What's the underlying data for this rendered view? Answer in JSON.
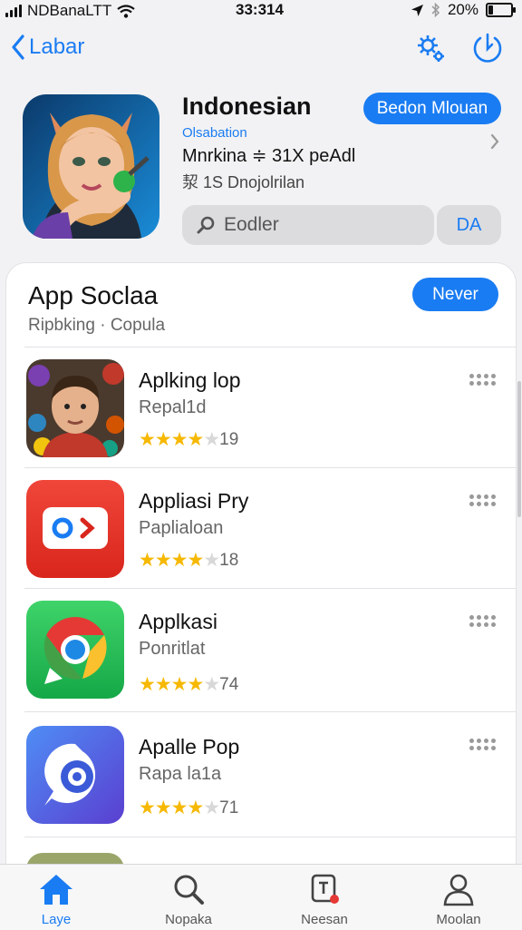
{
  "status": {
    "carrier": "NDBanaLTT",
    "time": "33:314",
    "battery": "20%"
  },
  "nav": {
    "back_label": "Labar",
    "icons": [
      "settings-gear-icon",
      "update-clock-icon"
    ]
  },
  "app": {
    "title": "Indonesian",
    "subtitle": "Olsabation",
    "line1": "Mnrkina ≑ 31X peAdl",
    "line2": "洯 1S Dnojolrilan",
    "get_label": "Bedon Mlouan",
    "search_placeholder": "Eodler",
    "search_button": "DA"
  },
  "section": {
    "title": "App Soclaa",
    "subtitle": "Ripbking · Copula",
    "button_label": "Never"
  },
  "apps": [
    {
      "name": "Aplking lop",
      "developer": "Repal1d",
      "stars": 4,
      "rating_count": "19"
    },
    {
      "name": "Appliasi Pry",
      "developer": "Paplialoan",
      "stars": 4,
      "rating_count": "18"
    },
    {
      "name": "Applkasi",
      "developer": "Ponritlat",
      "stars": 4,
      "rating_count": "74"
    },
    {
      "name": "Apalle Pop",
      "developer": "Rapa la1a",
      "stars": 4,
      "rating_count": "71"
    }
  ],
  "tabs": [
    {
      "label": "Laye",
      "icon": "home-icon",
      "active": true
    },
    {
      "label": "Nopaka",
      "icon": "search-icon",
      "active": false
    },
    {
      "label": "Neesan",
      "icon": "notification-badge-icon",
      "active": false
    },
    {
      "label": "Moolan",
      "icon": "person-icon",
      "active": false
    }
  ],
  "colors": {
    "accent": "#1a7cf2",
    "star": "#f6b800"
  }
}
